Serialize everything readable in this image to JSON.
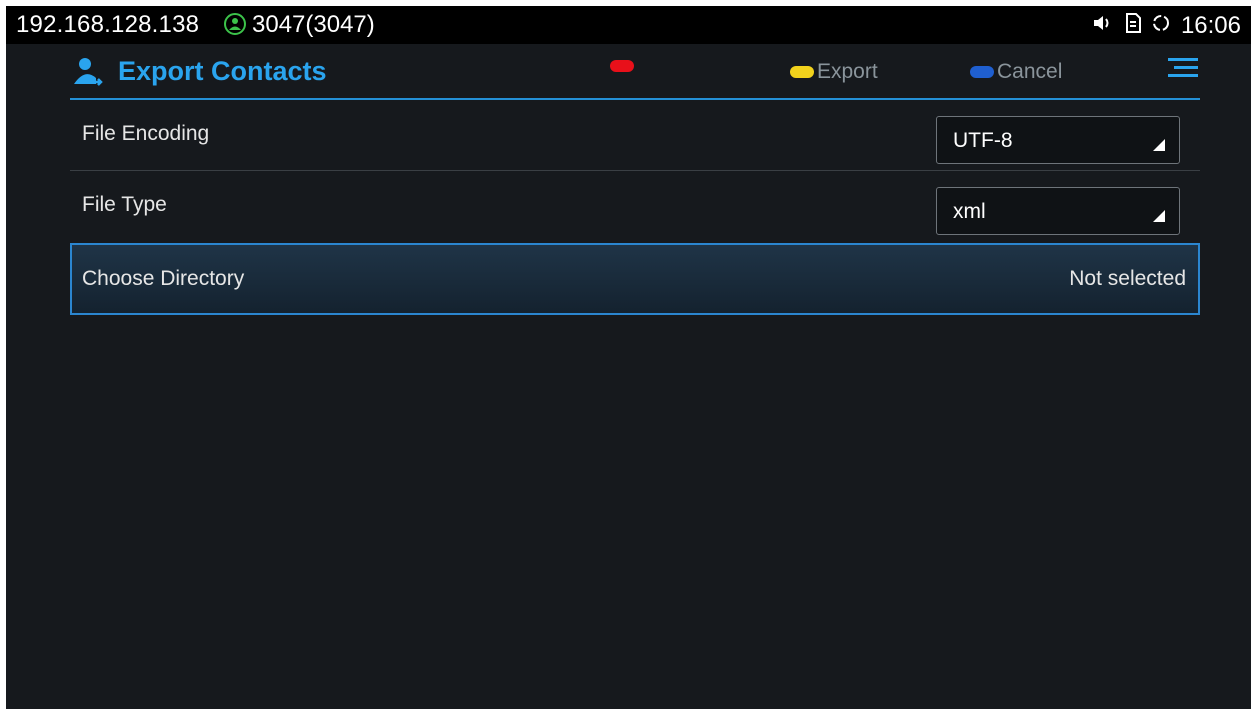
{
  "status_bar": {
    "ip": "192.168.128.138",
    "account": "3047(3047)",
    "time": "16:06",
    "icons": [
      "account-icon",
      "volume-icon",
      "sd-card-icon",
      "sync-icon"
    ]
  },
  "header": {
    "title": "Export Contacts",
    "title_icon": "contact-export-icon",
    "softkeys": [
      {
        "color": "#e8101a",
        "label": ""
      },
      {
        "color": "#f2d21c",
        "label": "Export"
      },
      {
        "color": "#1f5fd0",
        "label": "Cancel"
      }
    ],
    "menu_icon": "menu-icon",
    "accent": "#2aa4ee"
  },
  "rows": [
    {
      "label": "File Encoding",
      "value": "UTF-8"
    },
    {
      "label": "File Type",
      "value": "xml"
    },
    {
      "label": "Choose Directory",
      "value": "Not selected"
    }
  ]
}
